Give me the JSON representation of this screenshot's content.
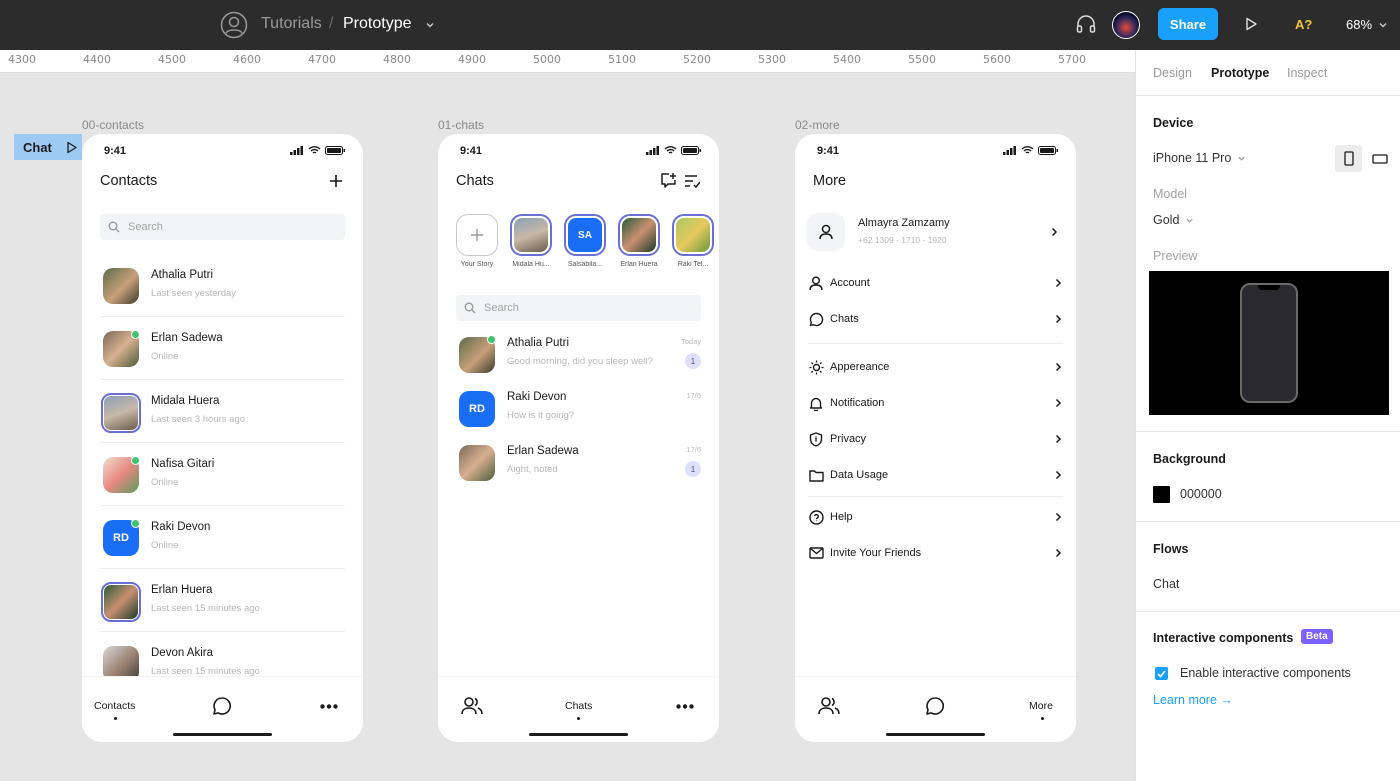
{
  "topbar": {
    "project": "Tutorials",
    "separator": "/",
    "file": "Prototype",
    "share": "Share",
    "a11y": "A?",
    "zoom": "68%"
  },
  "ruler": [
    "4300",
    "4400",
    "4500",
    "4600",
    "4700",
    "4800",
    "4900",
    "5000",
    "5100",
    "5200",
    "5300",
    "5400",
    "5500",
    "5600",
    "5700"
  ],
  "canvas": {
    "flow_tag": "Chat",
    "frames": [
      "00-contacts",
      "01-chats",
      "02-more"
    ]
  },
  "status_time": "9:41",
  "contacts": {
    "title": "Contacts",
    "search_placeholder": "Search",
    "items": [
      {
        "name": "Athalia Putri",
        "status": "Last seen yesterday"
      },
      {
        "name": "Erlan Sadewa",
        "status": "Online"
      },
      {
        "name": "Midala Huera",
        "status": "Last seen 3 hours ago"
      },
      {
        "name": "Nafisa Gitari",
        "status": "Online"
      },
      {
        "name": "Raki Devon",
        "status": "Online",
        "initials": "RD"
      },
      {
        "name": "Erlan Huera",
        "status": "Last seen 15 minutes ago"
      },
      {
        "name": "Devon Akira",
        "status": "Last seen 15 minutes ago"
      }
    ],
    "tabs": {
      "contacts": "Contacts"
    }
  },
  "chats": {
    "title": "Chats",
    "stories": [
      {
        "label": "Your Story"
      },
      {
        "label": "Midala Hu..."
      },
      {
        "label": "Salsabila...",
        "initials": "SA"
      },
      {
        "label": "Erlan Huera"
      },
      {
        "label": "Raki Tel..."
      }
    ],
    "search_placeholder": "Search",
    "items": [
      {
        "name": "Athalia Putri",
        "message": "Good morning, did you sleep well?",
        "time": "Today",
        "unread": "1"
      },
      {
        "name": "Raki Devon",
        "message": "How is it going?",
        "time": "17/6",
        "initials": "RD"
      },
      {
        "name": "Erlan Sadewa",
        "message": "Aight, noted",
        "time": "17/6",
        "unread": "1"
      }
    ],
    "tabs": {
      "chats": "Chats"
    }
  },
  "more": {
    "title": "More",
    "profile": {
      "name": "Almayra Zamzamy",
      "phone": "+62 1309 - 1710 - 1920"
    },
    "items": [
      "Account",
      "Chats",
      "Appereance",
      "Notification",
      "Privacy",
      "Data Usage",
      "Help",
      "Invite Your Friends"
    ],
    "tabs": {
      "more": "More"
    }
  },
  "panel": {
    "tabs": [
      "Design",
      "Prototype",
      "Inspect"
    ],
    "device_heading": "Device",
    "device": "iPhone 11 Pro",
    "model_label": "Model",
    "model": "Gold",
    "preview_label": "Preview",
    "background_heading": "Background",
    "background_value": "000000",
    "flows_heading": "Flows",
    "flow": "Chat",
    "interactive_heading": "Interactive components",
    "beta": "Beta",
    "enable_label": "Enable interactive components",
    "learn_more": "Learn more →"
  },
  "colors": {
    "accent": "#18a0fb",
    "blue_avatar": "#1a6ef5",
    "online": "#3cc46e",
    "beta": "#7b61ff"
  }
}
